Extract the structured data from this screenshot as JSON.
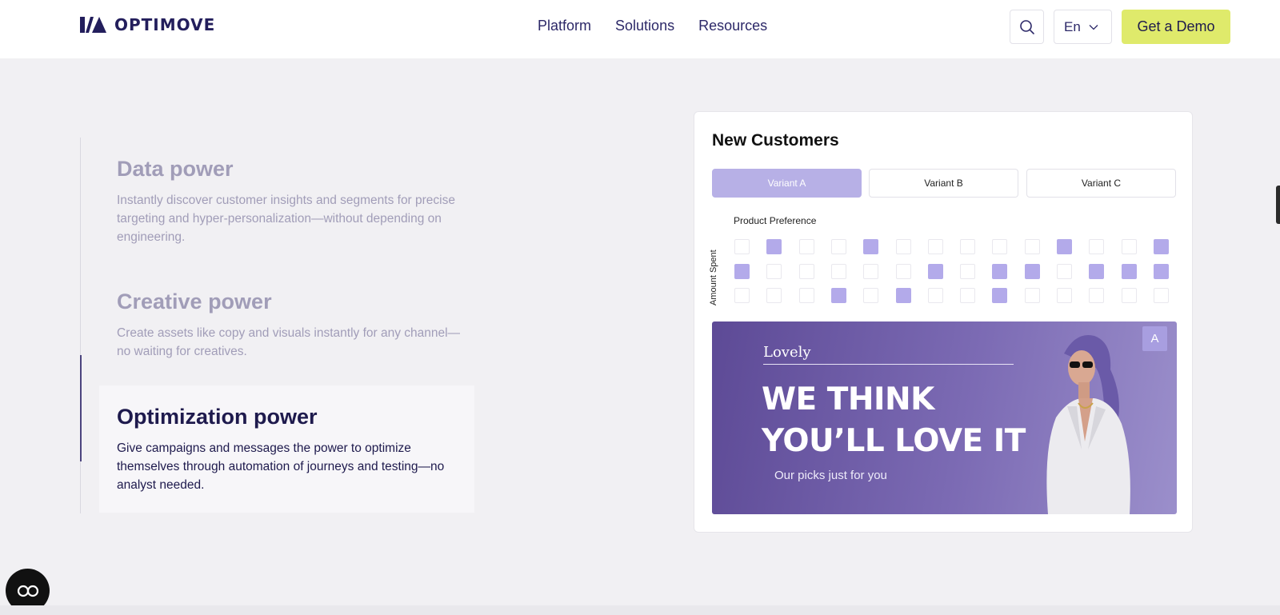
{
  "header": {
    "logo_text": "OPTIMOVE",
    "nav": [
      "Platform",
      "Solutions",
      "Resources"
    ],
    "language": "En",
    "cta_label": "Get a Demo"
  },
  "features": [
    {
      "title": "Data power",
      "description": "Instantly discover customer insights and segments for precise targeting and hyper-personalization—without depending on engineering.",
      "active": false
    },
    {
      "title": "Creative power",
      "description": "Create assets like copy and visuals instantly for any channel—no waiting for creatives.",
      "active": false
    },
    {
      "title": "Optimization power",
      "description": "Give campaigns and messages the power to optimize themselves through automation of journeys and testing—no analyst needed.",
      "active": true
    }
  ],
  "card": {
    "title": "New Customers",
    "variants": [
      "Variant A",
      "Variant B",
      "Variant C"
    ],
    "selected_variant": "Variant A",
    "x_label": "Product Preference",
    "y_label": "Amount Spent",
    "grid": [
      [
        0,
        1,
        0,
        0,
        1,
        0,
        0,
        0,
        0,
        0,
        1,
        0,
        0,
        1
      ],
      [
        1,
        0,
        0,
        0,
        0,
        0,
        1,
        0,
        1,
        1,
        0,
        1,
        1,
        1
      ],
      [
        0,
        0,
        0,
        1,
        0,
        1,
        0,
        0,
        1,
        0,
        0,
        0,
        0,
        0
      ]
    ],
    "banner": {
      "brand": "Lovely",
      "headline_line1": "WE THINK",
      "headline_line2": "YOU’LL LOVE IT",
      "subtext": "Our picks just for you",
      "badge": "A"
    }
  },
  "colors": {
    "accent_yellow": "#dfea6b",
    "brand_navy": "#231e5c",
    "variant_active": "#b7b0e6",
    "grid_on": "#b3aaea"
  }
}
